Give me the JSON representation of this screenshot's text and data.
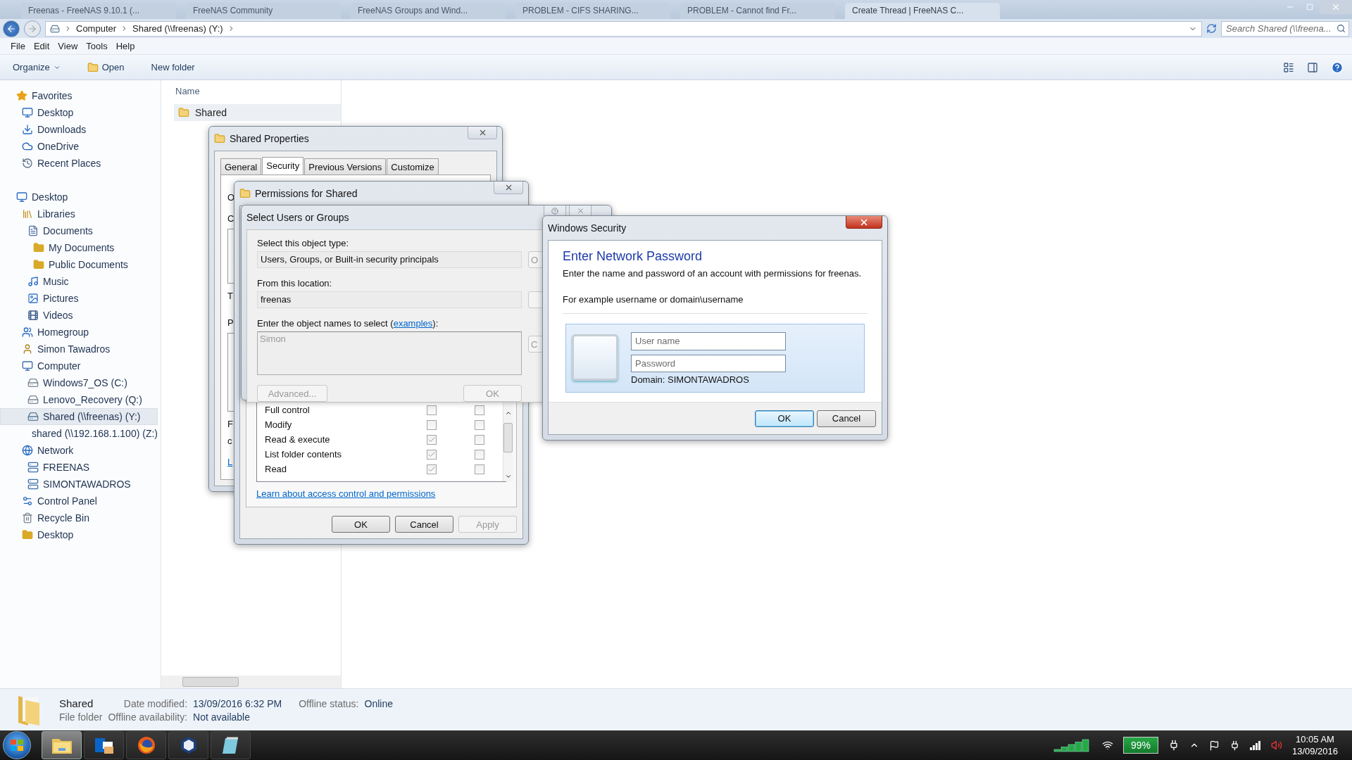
{
  "browser_tabs": [
    {
      "label": "Freenas - FreeNAS 9.10.1 (...",
      "selected": false
    },
    {
      "label": "FreeNAS Community",
      "selected": false
    },
    {
      "label": "FreeNAS Groups and Wind...",
      "selected": false
    },
    {
      "label": "PROBLEM - CIFS SHARING...",
      "selected": false
    },
    {
      "label": "PROBLEM - Cannot find Fr...",
      "selected": false
    },
    {
      "label": "Create Thread | FreeNAS C...",
      "selected": true
    }
  ],
  "address": {
    "crumbs": [
      "Computer",
      "Shared (\\\\freenas) (Y:)"
    ]
  },
  "search": {
    "placeholder": "Search Shared (\\\\freena..."
  },
  "menu": [
    "File",
    "Edit",
    "View",
    "Tools",
    "Help"
  ],
  "toolbar": [
    {
      "label": "Organize",
      "kind": "dropdown"
    },
    {
      "label": "Open",
      "kind": "icon"
    },
    {
      "label": "New folder",
      "kind": "plain"
    }
  ],
  "sidebar": {
    "items": [
      {
        "label": "Favorites",
        "kind": "favorites",
        "selected": false,
        "children": [
          {
            "label": "Desktop",
            "kind": "desktop",
            "selected": false
          },
          {
            "label": "Downloads",
            "kind": "downloads",
            "selected": false
          },
          {
            "label": "OneDrive",
            "kind": "cloud",
            "selected": false
          },
          {
            "label": "Recent Places",
            "kind": "recent",
            "selected": false
          }
        ]
      },
      {
        "label": "Desktop",
        "kind": "desktop",
        "selected": false,
        "children": [
          {
            "label": "Libraries",
            "kind": "libraries",
            "selected": false,
            "children": [
              {
                "label": "Documents",
                "kind": "documents",
                "selected": false,
                "children": [
                  {
                    "label": "My Documents",
                    "kind": "folder",
                    "selected": false
                  },
                  {
                    "label": "Public Documents",
                    "kind": "folder",
                    "selected": false
                  }
                ]
              },
              {
                "label": "Music",
                "kind": "music",
                "selected": false
              },
              {
                "label": "Pictures",
                "kind": "pictures",
                "selected": false
              },
              {
                "label": "Videos",
                "kind": "videos",
                "selected": false
              }
            ]
          },
          {
            "label": "Homegroup",
            "kind": "homegroup",
            "selected": false
          },
          {
            "label": "Simon Tawadros",
            "kind": "user",
            "selected": false
          },
          {
            "label": "Computer",
            "kind": "computer",
            "selected": false,
            "children": [
              {
                "label": "Windows7_OS (C:)",
                "kind": "drive",
                "selected": false
              },
              {
                "label": "Lenovo_Recovery (Q:)",
                "kind": "drive",
                "selected": false
              },
              {
                "label": "Shared (\\\\freenas) (Y:)",
                "kind": "netdrive",
                "selected": true
              },
              {
                "label": "shared (\\\\192.168.1.100) (Z:)",
                "kind": "netdrive-error",
                "selected": false
              }
            ]
          },
          {
            "label": "Network",
            "kind": "network",
            "selected": false,
            "children": [
              {
                "label": "FREENAS",
                "kind": "server",
                "selected": false
              },
              {
                "label": "SIMONTAWADROS",
                "kind": "server",
                "selected": false
              }
            ]
          },
          {
            "label": "Control Panel",
            "kind": "control-panel",
            "selected": false
          },
          {
            "label": "Recycle Bin",
            "kind": "recycle-bin",
            "selected": false
          },
          {
            "label": "Desktop",
            "kind": "folder",
            "selected": false
          }
        ]
      }
    ]
  },
  "file_list": {
    "column": "Name",
    "rows": [
      {
        "name": "Shared",
        "selected": true
      }
    ]
  },
  "details": {
    "name": "Shared",
    "type": "File folder",
    "fields": [
      {
        "label": "Date modified:",
        "value": "13/09/2016 6:32 PM"
      },
      {
        "label": "Offline availability:",
        "value": "Not available"
      },
      {
        "label": "Offline status:",
        "value": "Online"
      }
    ]
  },
  "properties_dialog": {
    "title": "Shared Properties",
    "tabs": [
      {
        "label": "General",
        "selected": false
      },
      {
        "label": "Security",
        "selected": true
      },
      {
        "label": "Previous Versions",
        "selected": false
      },
      {
        "label": "Customize",
        "selected": false
      }
    ],
    "clipped_items": [
      {
        "kind": "label",
        "text": "O"
      },
      {
        "kind": "label",
        "text": "C"
      },
      {
        "kind": "box"
      },
      {
        "kind": "label",
        "text": "T"
      },
      {
        "kind": "label",
        "text": "P"
      },
      {
        "kind": "box"
      },
      {
        "kind": "label",
        "text": "F"
      },
      {
        "kind": "label",
        "text": "c"
      },
      {
        "kind": "link",
        "text": "L"
      }
    ]
  },
  "permissions_dialog": {
    "title": "Permissions for Shared",
    "permissions": [
      {
        "name": "Full control",
        "allow": false,
        "deny": false
      },
      {
        "name": "Modify",
        "allow": false,
        "deny": false
      },
      {
        "name": "Read & execute",
        "allow": true,
        "deny": false
      },
      {
        "name": "List folder contents",
        "allow": true,
        "deny": false
      },
      {
        "name": "Read",
        "allow": true,
        "deny": false
      }
    ],
    "link": "Learn about access control and permissions",
    "buttons": [
      {
        "label": "OK",
        "disabled": false
      },
      {
        "label": "Cancel",
        "disabled": false
      },
      {
        "label": "Apply",
        "disabled": true
      }
    ]
  },
  "select_dialog": {
    "title": "Select Users or Groups",
    "object_type_label": "Select this object type:",
    "object_type": "Users, Groups, or Built-in security principals",
    "location_label": "From this location:",
    "location": "freenas",
    "names_label": "Enter the object names to select (",
    "names_link": "examples",
    "names_label_end": "):",
    "names_value": "Simon",
    "side_buttons": [
      "O",
      "C"
    ],
    "buttons": [
      {
        "label": "Advanced...",
        "disabled": true
      },
      {
        "label": "OK",
        "disabled": true
      }
    ]
  },
  "security_dialog": {
    "title": "Windows Security",
    "heading": "Enter Network Password",
    "description": "Enter the name and password of an account with permissions for freenas.",
    "example": "For example username or domain\\username",
    "username": {
      "placeholder": "User name"
    },
    "password": {
      "placeholder": "Password"
    },
    "domain": "Domain: SIMONTAWADROS",
    "buttons": [
      {
        "label": "OK",
        "default": true
      },
      {
        "label": "Cancel",
        "default": false
      }
    ]
  },
  "taskbar": {
    "apps": [
      {
        "kind": "explorer",
        "active": true
      },
      {
        "kind": "mail",
        "active": false
      },
      {
        "kind": "browser",
        "active": false
      },
      {
        "kind": "box",
        "active": false
      },
      {
        "kind": "notepad",
        "active": false
      }
    ],
    "battery": "99%",
    "time": "10:05 AM",
    "date": "13/09/2016"
  }
}
